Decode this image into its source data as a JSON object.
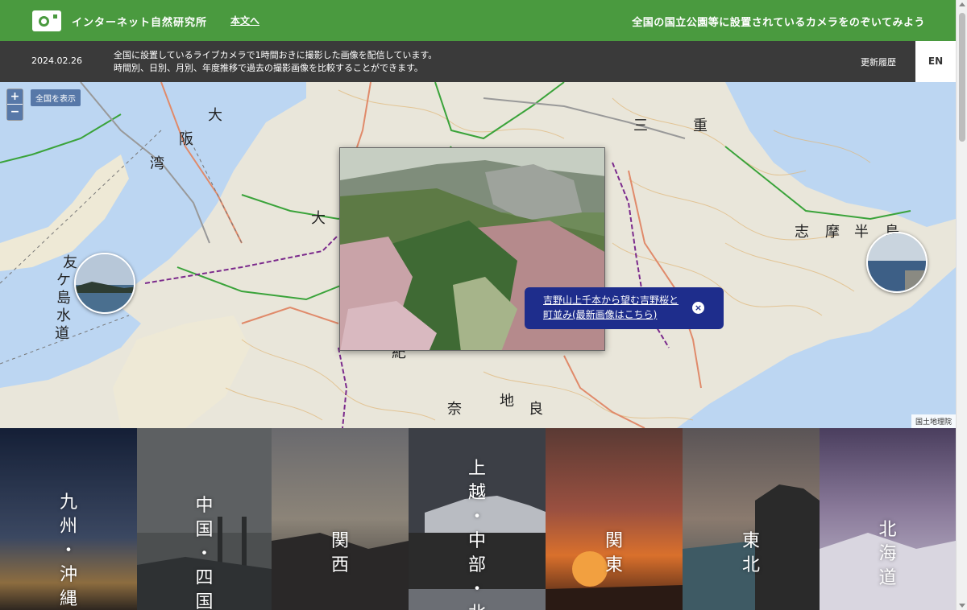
{
  "header": {
    "site_name": "インターネット自然研究所",
    "skip_link": "本文へ",
    "tagline": "全国の国立公園等に設置されているカメラをのぞいてみよう",
    "bg_color": "#4a9a3f"
  },
  "infobar": {
    "date": "2024.02.26",
    "desc_line1": "全国に設置しているライブカメラで1時間おきに撮影した画像を配信しています。",
    "desc_line2": "時間別、日別、月別、年度推移で過去の撮影画像を比較することができます。",
    "history_link": "更新履歴",
    "lang_button": "EN"
  },
  "map": {
    "zoom_in": "+",
    "zoom_out": "−",
    "show_all": "全国を表示",
    "attribution": "国土地理院",
    "callout_text": "吉野山上千本から望む吉野桜と町並み(最新画像はこちら)",
    "callout_close": "×",
    "labels": [
      "大",
      "阪",
      "湾",
      "三",
      "重",
      "大",
      "志",
      "摩",
      "半",
      "島",
      "友",
      "ケ",
      "島",
      "水",
      "道",
      "紀",
      "奈",
      "良",
      "地"
    ]
  },
  "regions": [
    {
      "name": "九州・沖縄",
      "chars": [
        "九",
        "州",
        "・",
        "沖",
        "縄"
      ]
    },
    {
      "name": "中国・四国",
      "chars": [
        "中",
        "国",
        "・",
        "四",
        "国"
      ]
    },
    {
      "name": "関西",
      "chars": [
        "関",
        "西"
      ]
    },
    {
      "name": "上越・中部・北陸",
      "chars": [
        "上",
        "越",
        "・",
        "中",
        "部",
        "・",
        "北"
      ]
    },
    {
      "name": "関東",
      "chars": [
        "関",
        "東"
      ]
    },
    {
      "name": "東北",
      "chars": [
        "東",
        "北"
      ]
    },
    {
      "name": "北海道",
      "chars": [
        "北",
        "海",
        "道"
      ]
    }
  ]
}
